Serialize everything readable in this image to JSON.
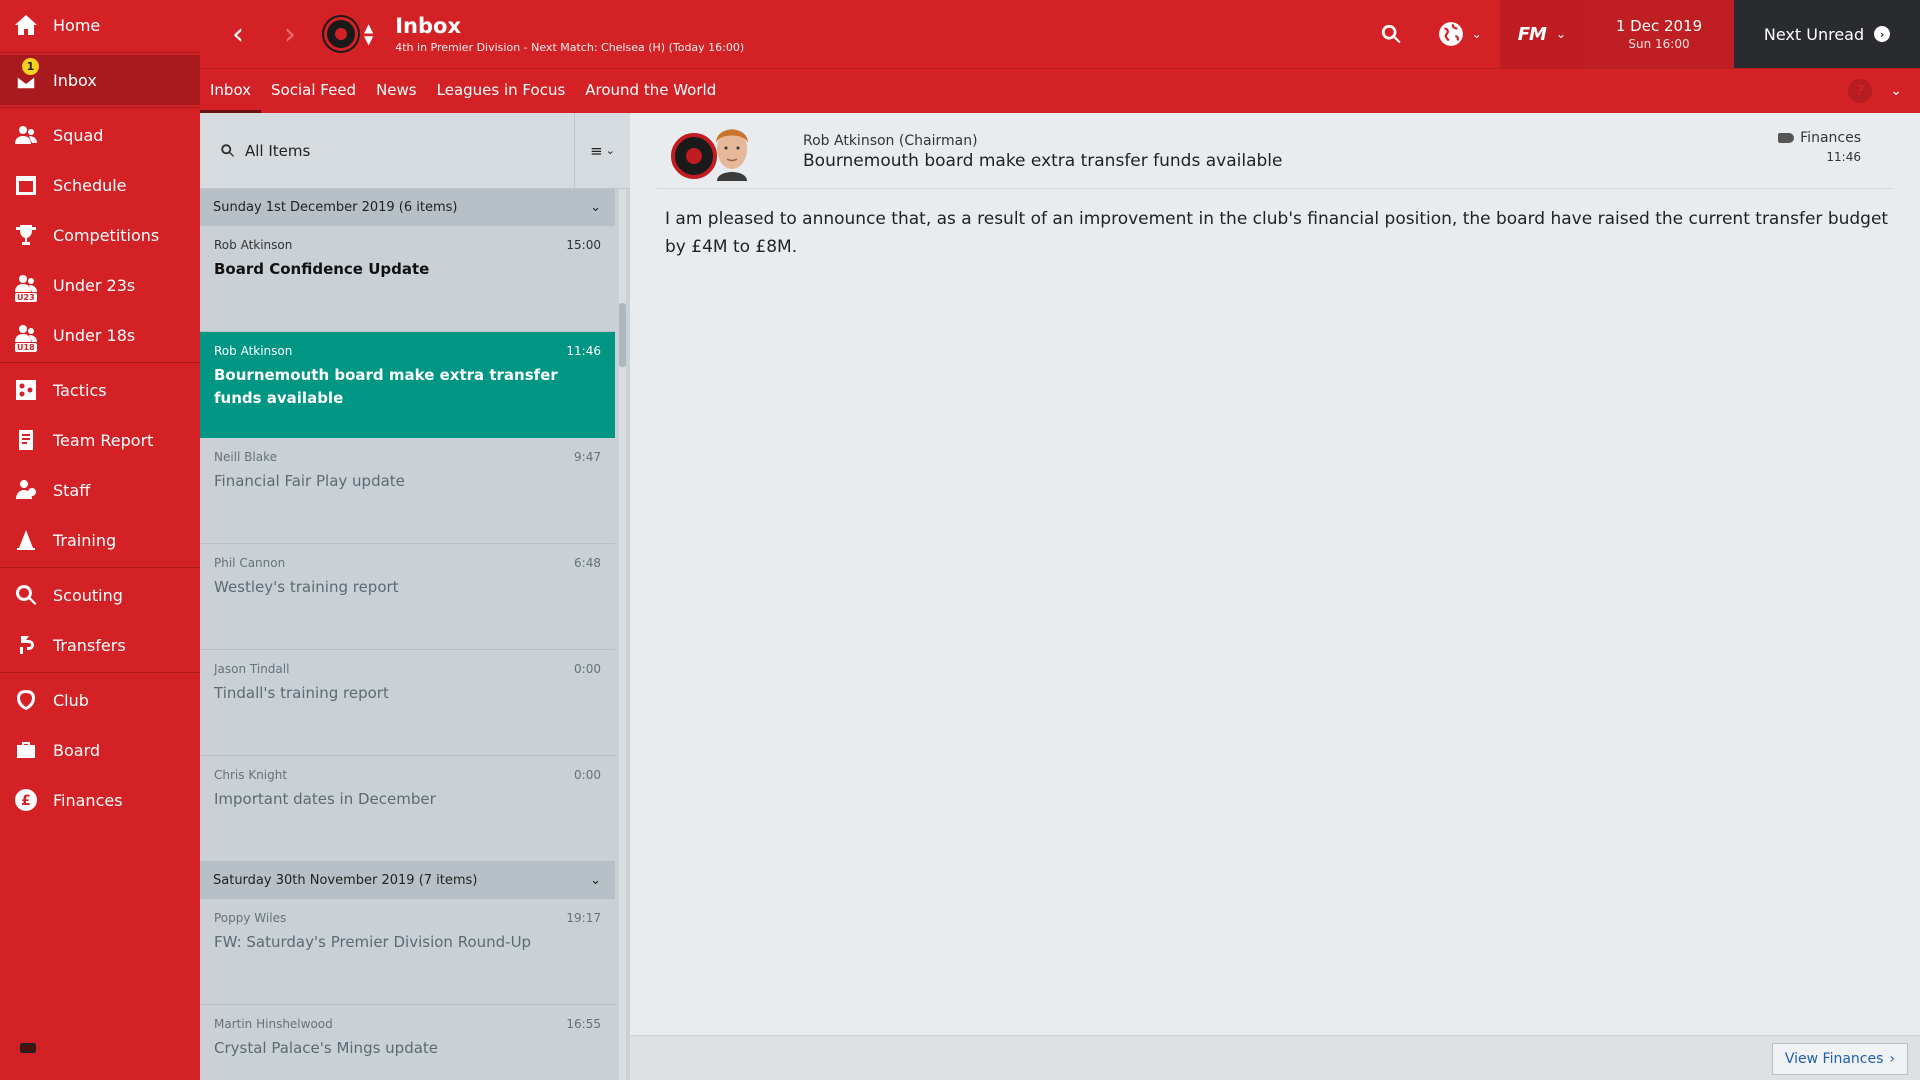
{
  "sidebar": {
    "items": [
      {
        "label": "Home",
        "icon": "home-icon"
      },
      {
        "label": "Inbox",
        "icon": "inbox-icon",
        "badge": "1"
      },
      {
        "label": "Squad",
        "icon": "squad-icon"
      },
      {
        "label": "Schedule",
        "icon": "calendar-icon"
      },
      {
        "label": "Competitions",
        "icon": "trophy-icon"
      },
      {
        "label": "Under 23s",
        "icon": "squad-icon",
        "tag": "U23"
      },
      {
        "label": "Under 18s",
        "icon": "squad-icon",
        "tag": "U18"
      },
      {
        "label": "Tactics",
        "icon": "tactics-icon"
      },
      {
        "label": "Team Report",
        "icon": "report-icon"
      },
      {
        "label": "Staff",
        "icon": "staff-icon"
      },
      {
        "label": "Training",
        "icon": "cone-icon"
      },
      {
        "label": "Scouting",
        "icon": "search-icon"
      },
      {
        "label": "Transfers",
        "icon": "transfer-icon"
      },
      {
        "label": "Club",
        "icon": "shield-icon"
      },
      {
        "label": "Board",
        "icon": "briefcase-icon"
      },
      {
        "label": "Finances",
        "icon": "pound-icon"
      }
    ]
  },
  "header": {
    "title": "Inbox",
    "subtitle": "4th in Premier Division - Next Match: Chelsea (H) (Today 16:00)",
    "date": "1 Dec 2019",
    "time": "Sun 16:00",
    "fm_logo": "FM",
    "next_unread": "Next Unread"
  },
  "tabs": [
    "Inbox",
    "Social Feed",
    "News",
    "Leagues in Focus",
    "Around the World"
  ],
  "help_label": "?",
  "list": {
    "search_label": "All Items",
    "groups": [
      {
        "title": "Sunday 1st December 2019 (6 items)",
        "messages": [
          {
            "from": "Rob Atkinson",
            "time": "15:00",
            "subject": "Board Confidence Update"
          },
          {
            "from": "Rob Atkinson",
            "time": "11:46",
            "subject": "Bournemouth board make extra transfer funds available"
          },
          {
            "from": "Neill Blake",
            "time": "9:47",
            "subject": "Financial Fair Play update"
          },
          {
            "from": "Phil Cannon",
            "time": "6:48",
            "subject": "Westley's training report"
          },
          {
            "from": "Jason Tindall",
            "time": "0:00",
            "subject": "Tindall's training report"
          },
          {
            "from": "Chris Knight",
            "time": "0:00",
            "subject": "Important dates in December"
          }
        ]
      },
      {
        "title": "Saturday 30th November 2019 (7 items)",
        "messages": [
          {
            "from": "Poppy Wiles",
            "time": "19:17",
            "subject": "FW: Saturday's Premier Division Round-Up"
          },
          {
            "from": "Martin Hinshelwood",
            "time": "16:55",
            "subject": "Crystal Palace's Mings update"
          }
        ]
      }
    ]
  },
  "message": {
    "sender": "Rob Atkinson",
    "role": "(Chairman)",
    "headline": "Bournemouth board make extra transfer funds available",
    "category": "Finances",
    "time": "11:46",
    "body": "I am pleased to announce that, as a result of an improvement in the club's financial position, the board have raised the current transfer budget by £4M to £8M.",
    "action_button": "View Finances"
  },
  "colors": {
    "primary": "#d42126",
    "selected_row": "#009684",
    "next_unread_bg": "#2a2b2e",
    "link": "#1f5fae"
  }
}
